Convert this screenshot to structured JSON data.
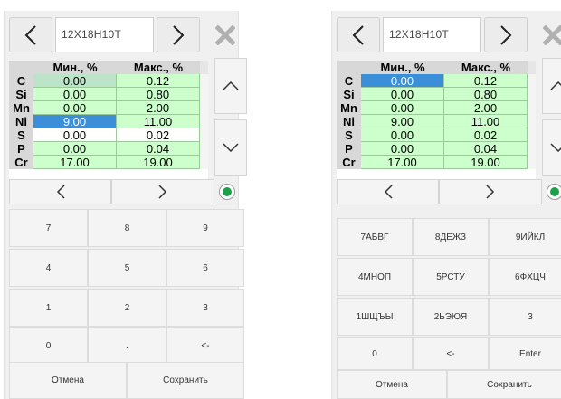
{
  "left": {
    "code": "12Х18Н10Т",
    "headers": [
      "Мин., %",
      "Макс., %"
    ],
    "rows": [
      {
        "el": "C",
        "min": "0.00",
        "max": "0.12"
      },
      {
        "el": "Si",
        "min": "0.00",
        "max": "0.80"
      },
      {
        "el": "Mn",
        "min": "0.00",
        "max": "2.00"
      },
      {
        "el": "Ni",
        "min": "9.00",
        "max": "11.00"
      },
      {
        "el": "S",
        "min": "0.00",
        "max": "0.02"
      },
      {
        "el": "P",
        "min": "0.00",
        "max": "0.04"
      },
      {
        "el": "Cr",
        "min": "17.00",
        "max": "19.00"
      }
    ],
    "keys": [
      "7",
      "8",
      "9",
      "4",
      "5",
      "6",
      "1",
      "2",
      "3",
      "0",
      ".",
      "<-"
    ],
    "cancel": "Отмена",
    "save": "Сохранить"
  },
  "right": {
    "code": "12Х18Н10Т",
    "headers": [
      "Мин., %",
      "Макс., %"
    ],
    "rows": [
      {
        "el": "C",
        "min": "0.00",
        "max": "0.12"
      },
      {
        "el": "Si",
        "min": "0.00",
        "max": "0.80"
      },
      {
        "el": "Mn",
        "min": "0.00",
        "max": "2.00"
      },
      {
        "el": "Ni",
        "min": "9.00",
        "max": "11.00"
      },
      {
        "el": "S",
        "min": "0.00",
        "max": "0.02"
      },
      {
        "el": "P",
        "min": "0.00",
        "max": "0.04"
      },
      {
        "el": "Cr",
        "min": "17.00",
        "max": "19.00"
      }
    ],
    "keys": [
      "7АБВГ",
      "8ДЕЖЗ",
      "9ИЙКЛ",
      "4МНОП",
      "5РСТУ",
      "6ФХЦЧ",
      "1ШЩЪЫ",
      "2ЬЭЮЯ",
      "3",
      "0",
      "<-",
      "Enter"
    ],
    "cancel": "Отмена",
    "save": "Сохранить"
  },
  "colors": {
    "cell_green": "#ccffcc",
    "cell_selected": "#3b8fd9",
    "radio_active": "#1ea04a",
    "close_gray": "#b0b0b0"
  }
}
